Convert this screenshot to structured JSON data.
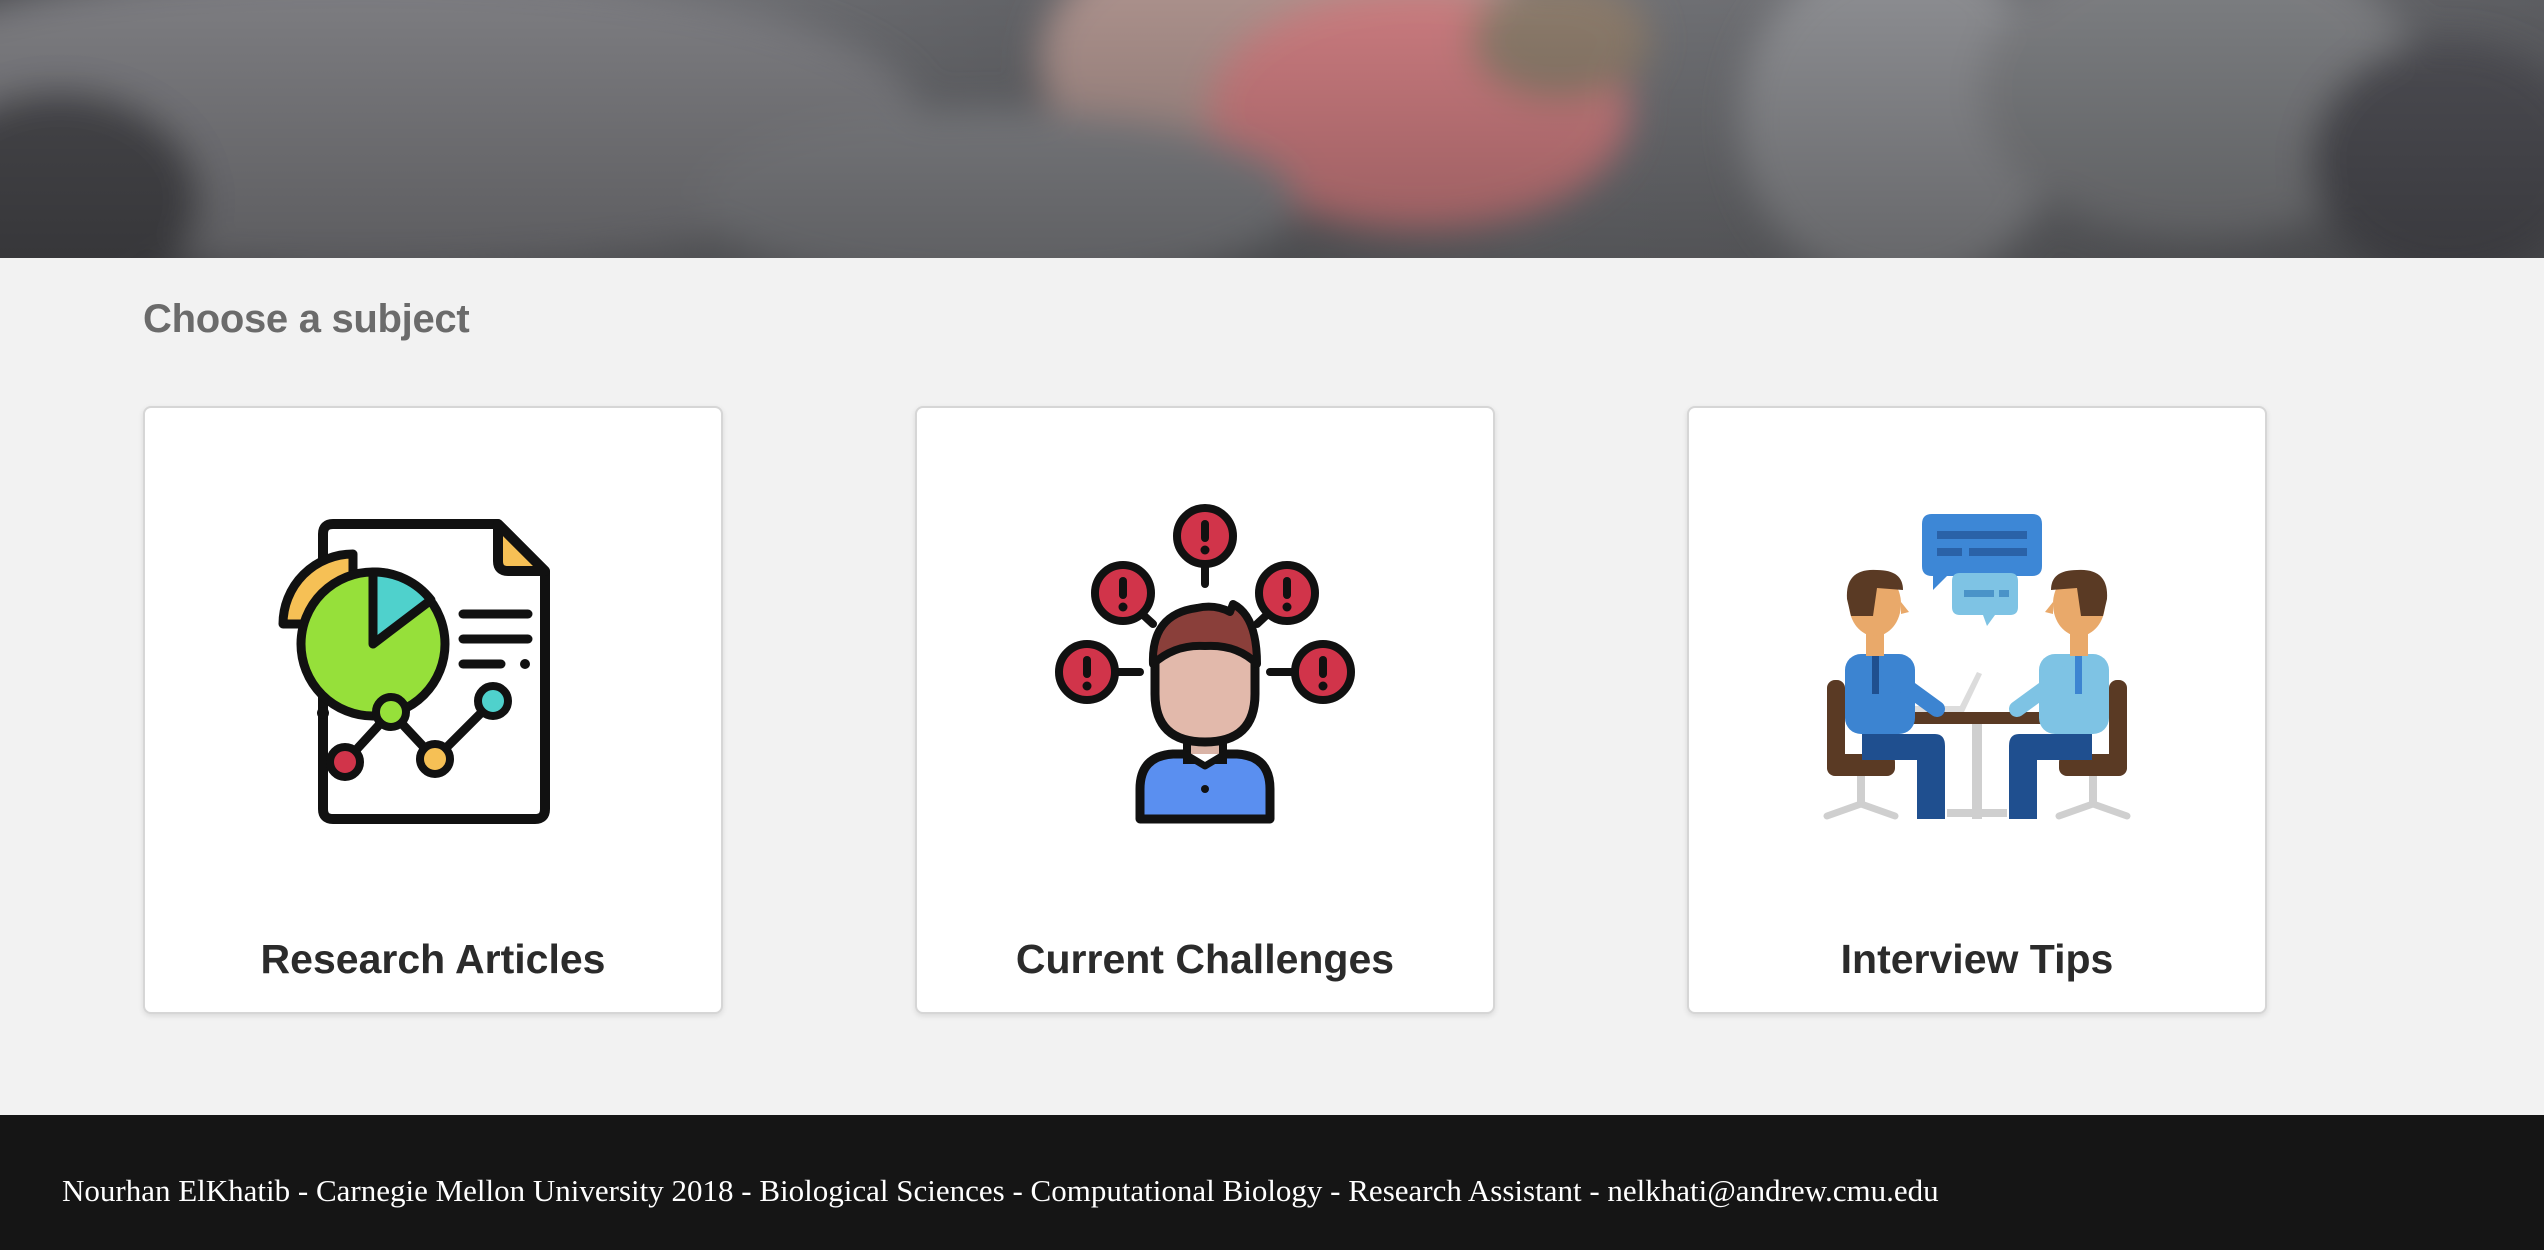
{
  "hero": {
    "image": "blurred-photo"
  },
  "subjects": {
    "heading": "Choose a subject",
    "cards": [
      {
        "label": "Research Articles",
        "icon": "report-chart-icon"
      },
      {
        "label": "Current Challenges",
        "icon": "person-alerts-icon"
      },
      {
        "label": "Interview Tips",
        "icon": "interview-meeting-icon"
      }
    ]
  },
  "footer": {
    "text": "Nourhan ElKhatib - Carnegie Mellon University 2018 - Biological Sciences - Computational Biology - Research Assistant - nelkhati@andrew.cmu.edu"
  },
  "colors": {
    "page_bg": "#f2f2f2",
    "footer_bg": "#151515",
    "heading": "#6b6b6b",
    "card_label": "#2b2b2b",
    "alert_red": "#d1344a",
    "chart_green": "#96e03a",
    "chart_yellow": "#f6c055",
    "chart_teal": "#4fd1cc",
    "shirt_blue": "#3c84d1",
    "bubble_blue": "#3d87d6"
  }
}
